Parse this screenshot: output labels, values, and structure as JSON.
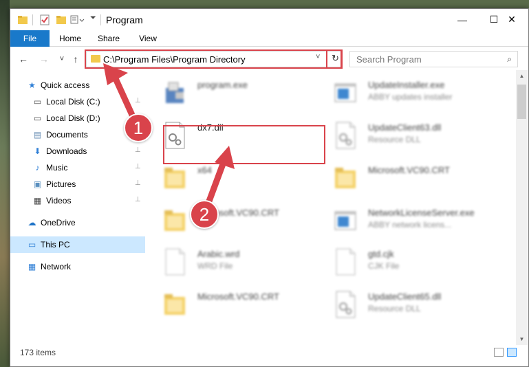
{
  "window": {
    "title": "Program",
    "minimize_glyph": "—",
    "maximize_glyph": "☐",
    "close_glyph": "✕"
  },
  "ribbon": {
    "tabs": [
      "File",
      "Home",
      "Share",
      "View"
    ]
  },
  "navbar": {
    "back_glyph": "←",
    "forward_glyph": "→",
    "recent_glyph": "˅",
    "up_glyph": "↑",
    "address": "C:\\Program Files\\Program Directory",
    "address_dropdown_glyph": "˅",
    "refresh_glyph": "↻",
    "search_placeholder": "Search Program",
    "search_glyph": "⌕"
  },
  "sidebar": {
    "items": [
      {
        "label": "Quick access",
        "icon": "star-icon",
        "glyph": "★",
        "color": "#2f7fd6",
        "pinned": false
      },
      {
        "label": "Local Disk (C:)",
        "icon": "drive-icon",
        "glyph": "▭",
        "color": "#555555",
        "pinned": true
      },
      {
        "label": "Local Disk (D:)",
        "icon": "drive-icon",
        "glyph": "▭",
        "color": "#555555",
        "pinned": true
      },
      {
        "label": "Documents",
        "icon": "documents-icon",
        "glyph": "▤",
        "color": "#6b8fb5",
        "pinned": true
      },
      {
        "label": "Downloads",
        "icon": "download-icon",
        "glyph": "⬇",
        "color": "#2f7fd6",
        "pinned": true
      },
      {
        "label": "Music",
        "icon": "music-icon",
        "glyph": "♪",
        "color": "#2f7fd6",
        "pinned": true
      },
      {
        "label": "Pictures",
        "icon": "pictures-icon",
        "glyph": "▣",
        "color": "#5a8fbf",
        "pinned": true
      },
      {
        "label": "Videos",
        "icon": "videos-icon",
        "glyph": "▦",
        "color": "#444444",
        "pinned": true
      },
      {
        "label": "OneDrive",
        "icon": "cloud-icon",
        "glyph": "☁",
        "color": "#1e73c8",
        "pinned": false
      },
      {
        "label": "This PC",
        "icon": "computer-icon",
        "glyph": "▭",
        "color": "#2f7fd6",
        "pinned": false
      },
      {
        "label": "Network",
        "icon": "network-icon",
        "glyph": "▦",
        "color": "#2f7fd6",
        "pinned": false
      }
    ],
    "pin_glyph": "📌"
  },
  "files": [
    {
      "name": "program.exe",
      "type": "",
      "kind": "exe-app"
    },
    {
      "name": "UpdateInstaller.exe",
      "type": "ABBY updates installer",
      "kind": "exe-window"
    },
    {
      "name": "dx7.dll",
      "type": "",
      "kind": "dll"
    },
    {
      "name": "UpdateClient63.dll",
      "type": "Resource DLL",
      "kind": "dll"
    },
    {
      "name": "x64",
      "type": "",
      "kind": "folder"
    },
    {
      "name": "Microsoft.VC90.CRT",
      "type": "",
      "kind": "folder"
    },
    {
      "name": "Microsoft.VC90.CRT",
      "type": "",
      "kind": "folder"
    },
    {
      "name": "NetworkLicenseServer.exe",
      "type": "ABBY network licens...",
      "kind": "exe-window"
    },
    {
      "name": "Arabic.wrd",
      "type": "WRD File",
      "kind": "file"
    },
    {
      "name": "gtd.cjk",
      "type": "CJK File",
      "kind": "file"
    },
    {
      "name": "Microsoft.VC90.CRT",
      "type": "",
      "kind": "folder"
    },
    {
      "name": "UpdateClient65.dll",
      "type": "Resource DLL",
      "kind": "dll"
    }
  ],
  "status": {
    "item_count": "173 items"
  },
  "annotations": {
    "step1": "1",
    "step2": "2",
    "color": "#d9434b"
  }
}
